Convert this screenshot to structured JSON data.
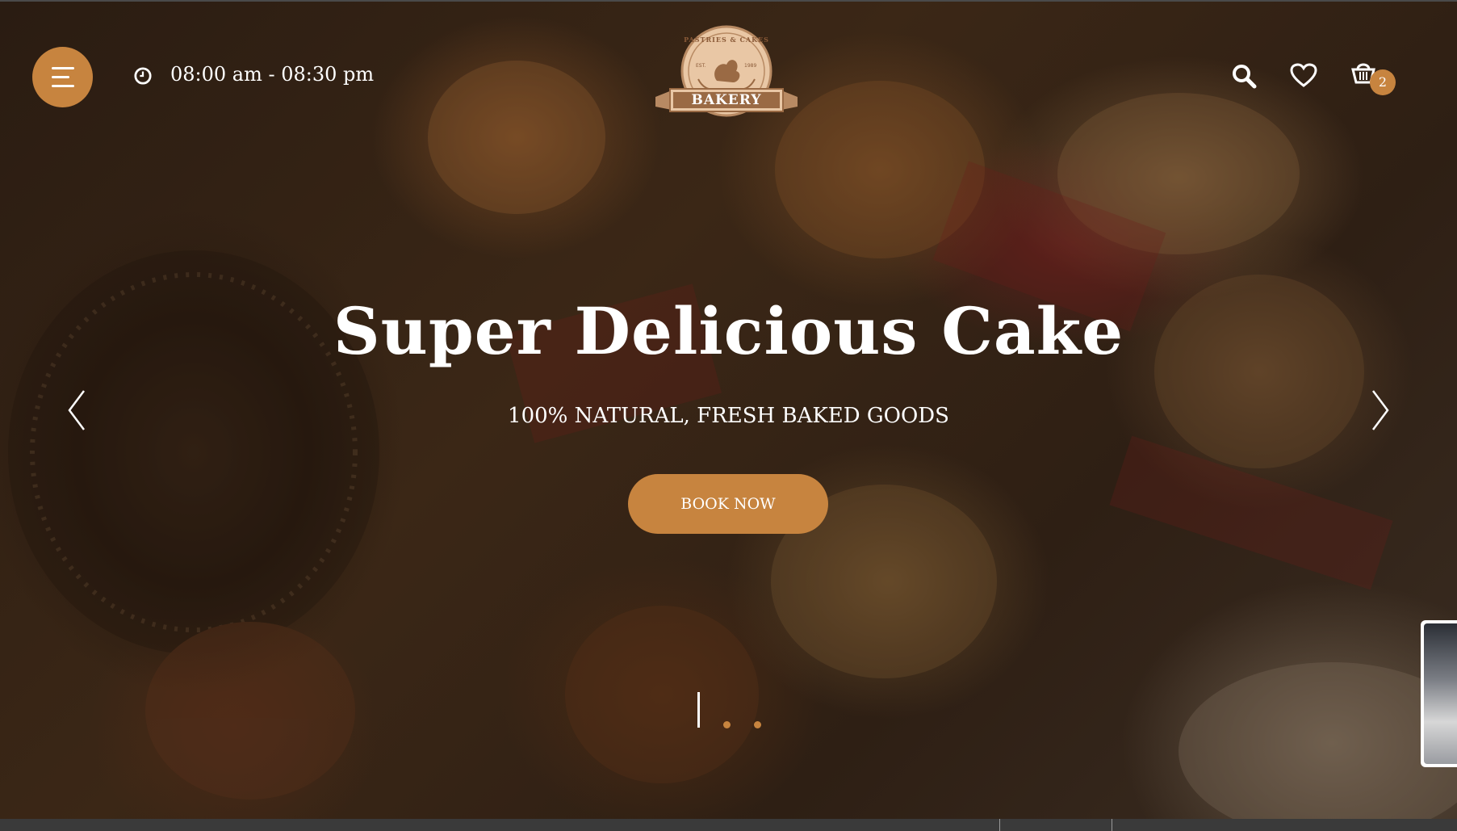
{
  "header": {
    "hours": "08:00 am - 08:30 pm",
    "cart_count": "2",
    "logo": {
      "top_text": "PASTRIES & CAKES",
      "est": "EST.",
      "year": "1989",
      "name": "BAKERY"
    },
    "icons": [
      "menu-icon",
      "clock-icon",
      "search-icon",
      "heart-icon",
      "basket-icon"
    ]
  },
  "hero": {
    "title": "Super Delicious Cake",
    "subtitle": "100% NATURAL, FRESH BAKED GOODS",
    "cta_label": "BOOK NOW",
    "slides_total": 3,
    "active_slide": 1
  },
  "colors": {
    "accent": "#c7843f",
    "text": "#ffffff",
    "overlay": "#2a1c12"
  }
}
